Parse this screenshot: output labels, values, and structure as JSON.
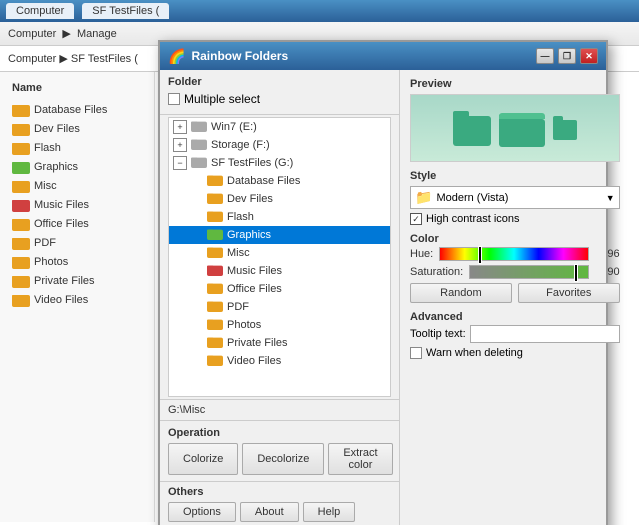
{
  "app": {
    "title": "Rainbow Folders",
    "taskbar_tabs": [
      "Computer",
      "SF TestFiles ("
    ]
  },
  "explorer": {
    "address": "Computer ▶ SF TestFiles (",
    "sidebar_header": "Name",
    "sidebar_items": [
      {
        "label": "Database Files",
        "color": "#e8a020"
      },
      {
        "label": "Dev Files",
        "color": "#e8a020"
      },
      {
        "label": "Flash",
        "color": "#e8a020"
      },
      {
        "label": "Graphics",
        "color": "#60b840"
      },
      {
        "label": "Misc",
        "color": "#e8a020"
      },
      {
        "label": "Music Files",
        "color": "#d04040"
      },
      {
        "label": "Office Files",
        "color": "#e8a020"
      },
      {
        "label": "PDF",
        "color": "#e8a020"
      },
      {
        "label": "Photos",
        "color": "#e8a020"
      },
      {
        "label": "Private Files",
        "color": "#e8a020"
      },
      {
        "label": "Video Files",
        "color": "#e8a020"
      }
    ]
  },
  "dialog": {
    "title": "Rainbow Folders",
    "folder_section_label": "Folder",
    "multiple_select_label": "Multiple select",
    "tree": {
      "items": [
        {
          "level": 0,
          "label": "Win7 (E:)",
          "expanded": false,
          "has_expander": true,
          "folder_color": "#aaa"
        },
        {
          "level": 0,
          "label": "Storage (F:)",
          "expanded": false,
          "has_expander": true,
          "folder_color": "#aaa"
        },
        {
          "level": 0,
          "label": "SF TestFiles (G:)",
          "expanded": true,
          "has_expander": true,
          "folder_color": "#aaa"
        },
        {
          "level": 1,
          "label": "Database Files",
          "expanded": false,
          "has_expander": false,
          "folder_color": "#e8a020"
        },
        {
          "level": 1,
          "label": "Dev Files",
          "expanded": false,
          "has_expander": false,
          "folder_color": "#e8a020"
        },
        {
          "level": 1,
          "label": "Flash",
          "expanded": false,
          "has_expander": false,
          "folder_color": "#e8a020"
        },
        {
          "level": 1,
          "label": "Graphics",
          "expanded": false,
          "has_expander": false,
          "folder_color": "#60b840",
          "selected": true
        },
        {
          "level": 1,
          "label": "Misc",
          "expanded": false,
          "has_expander": false,
          "folder_color": "#e8a020"
        },
        {
          "level": 1,
          "label": "Music Files",
          "expanded": false,
          "has_expander": false,
          "folder_color": "#d04040"
        },
        {
          "level": 1,
          "label": "Office Files",
          "expanded": false,
          "has_expander": false,
          "folder_color": "#e8a020"
        },
        {
          "level": 1,
          "label": "PDF",
          "expanded": false,
          "has_expander": false,
          "folder_color": "#e8a020"
        },
        {
          "level": 1,
          "label": "Photos",
          "expanded": false,
          "has_expander": false,
          "folder_color": "#e8a020"
        },
        {
          "level": 1,
          "label": "Private Files",
          "expanded": false,
          "has_expander": false,
          "folder_color": "#e8a020"
        },
        {
          "level": 1,
          "label": "Video Files",
          "expanded": false,
          "has_expander": false,
          "folder_color": "#e8a020"
        }
      ]
    },
    "path": "G:\\Misc",
    "operation_label": "Operation",
    "colorize_label": "Colorize",
    "decolorize_label": "Decolorize",
    "extract_color_label": "Extract color",
    "others_label": "Others",
    "options_label": "Options",
    "about_label": "About",
    "help_label": "Help",
    "preview_label": "Preview",
    "style_label": "Style",
    "style_value": "Modern (Vista)",
    "high_contrast_label": "High contrast icons",
    "color_label": "Color",
    "hue_label": "Hue:",
    "hue_value": "96",
    "saturation_label": "Saturation:",
    "saturation_value": "90",
    "random_label": "Random",
    "favorites_label": "Favorites",
    "advanced_label": "Advanced",
    "tooltip_text_label": "Tooltip text:",
    "warn_label": "Warn when deleting",
    "win_btn_minimize": "—",
    "win_btn_restore": "❐",
    "win_btn_close": "✕"
  }
}
